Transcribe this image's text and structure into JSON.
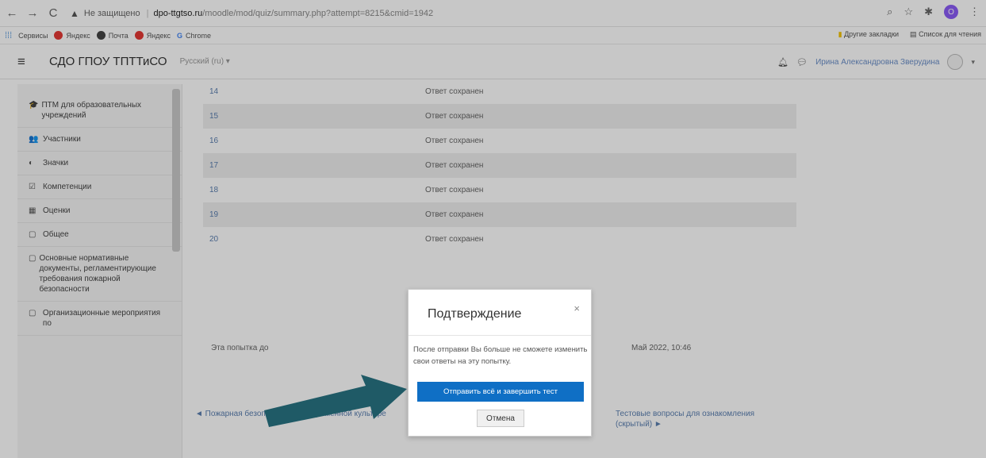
{
  "browser": {
    "back": "←",
    "forward": "→",
    "reload": "C",
    "insecure_label": "Не защищено",
    "host": "dpo-ttgtso.ru",
    "path": "/moodle/mod/quiz/summary.php?attempt=8215&cmid=1942",
    "profile_letter": "O"
  },
  "bookmarks": {
    "left": [
      {
        "label": "Сервисы",
        "color": "#4a90d9"
      },
      {
        "label": "Яндекс",
        "color": "#e53935"
      },
      {
        "label": "Почта",
        "color": "#444444"
      },
      {
        "label": "Яндекс",
        "color": "#e53935"
      },
      {
        "label": "Chrome",
        "color": "#4285f4"
      }
    ],
    "right": [
      "Другие закладки",
      "Список для чтения"
    ]
  },
  "navbar": {
    "brand": "СДО ГПОУ ТПТТиСО",
    "language": "Русский (ru) ▾",
    "user_name": "Ирина Александровна Зверудина"
  },
  "sidebar": {
    "items": [
      {
        "icon": "🎓",
        "label": "ПТМ для образовательных учреждений"
      },
      {
        "icon": "👥",
        "label": "Участники"
      },
      {
        "icon": "◐",
        "label": "Значки"
      },
      {
        "icon": "☑",
        "label": "Компетенции"
      },
      {
        "icon": "▦",
        "label": "Оценки"
      },
      {
        "icon": "▢",
        "label": "Общее"
      },
      {
        "icon": "▢",
        "label": "Основные нормативные документы, регламентирующие требования пожарной безопасности"
      },
      {
        "icon": "▢",
        "label": "Организационные мероприятия по"
      }
    ]
  },
  "summary": {
    "rows": [
      {
        "num": "14",
        "status": "Ответ сохранен"
      },
      {
        "num": "15",
        "status": "Ответ сохранен"
      },
      {
        "num": "16",
        "status": "Ответ сохранен"
      },
      {
        "num": "17",
        "status": "Ответ сохранен"
      },
      {
        "num": "18",
        "status": "Ответ сохранен"
      },
      {
        "num": "19",
        "status": "Ответ сохранен"
      },
      {
        "num": "20",
        "status": "Ответ сохранен"
      }
    ],
    "attempt_left": "Эта попытка до",
    "attempt_right": "Май 2022, 10:46"
  },
  "bottom_nav": {
    "prev": "◄ Пожарная безопасность в современной культуре",
    "next": "Тестовые вопросы для ознакомления (скрытый) ►"
  },
  "modal": {
    "title": "Подтверждение",
    "close": "×",
    "body": "После отправки Вы больше не сможете изменить свои ответы на эту попытку.",
    "primary_label": "Отправить всё и завершить тест",
    "secondary_label": "Отмена"
  },
  "colors": {
    "primary": "#0f6fc5",
    "arrow": "#1f5a66"
  }
}
